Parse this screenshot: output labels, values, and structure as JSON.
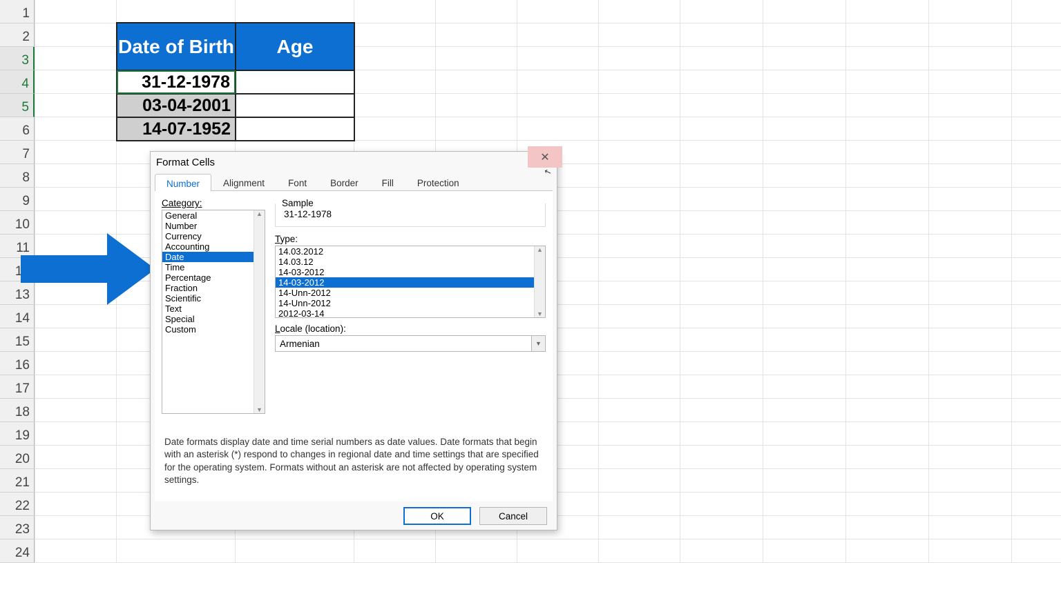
{
  "sheet": {
    "row_count": 24,
    "selected_rows": [
      3,
      4,
      5
    ],
    "table": {
      "headers": {
        "col_b": "Date of Birth",
        "col_c": "Age"
      },
      "rows": [
        {
          "dob": "31-12-1978",
          "age": ""
        },
        {
          "dob": "03-04-2001",
          "age": ""
        },
        {
          "dob": "14-07-1952",
          "age": ""
        }
      ]
    },
    "col_edges": [
      0,
      118,
      290,
      462,
      580,
      698,
      816,
      934,
      1054,
      1174,
      1294,
      1414
    ]
  },
  "dialog": {
    "title": "Format Cells",
    "help_icon": "?",
    "close_icon": "✕",
    "tabs": [
      "Number",
      "Alignment",
      "Font",
      "Border",
      "Fill",
      "Protection"
    ],
    "active_tab": 0,
    "category_label": "Category:",
    "categories": [
      "General",
      "Number",
      "Currency",
      "Accounting",
      "Date",
      "Time",
      "Percentage",
      "Fraction",
      "Scientific",
      "Text",
      "Special",
      "Custom"
    ],
    "selected_category_index": 4,
    "sample_label": "Sample",
    "sample_value": "31-12-1978",
    "type_label": "Type:",
    "type_items": [
      "14.03.2012",
      "14.03.12",
      "14-03-2012",
      "14-03-2012",
      "14-Unn-2012",
      "14-Unn-2012",
      "2012-03-14"
    ],
    "selected_type_index": 3,
    "locale_label": "Locale (location):",
    "locale_value": "Armenian",
    "description": "Date formats display date and time serial numbers as date values.  Date formats that begin with an asterisk (*) respond to changes in regional date and time settings that are specified for the operating system. Formats without an asterisk are not affected by operating system settings.",
    "ok_label": "OK",
    "cancel_label": "Cancel"
  },
  "arrow": {
    "caption": ""
  }
}
